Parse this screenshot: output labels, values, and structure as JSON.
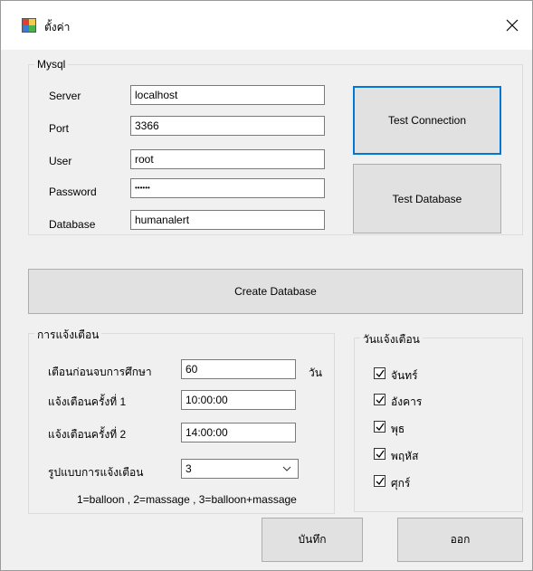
{
  "window": {
    "title": "ตั้งค่า",
    "close_glyph": "✕"
  },
  "mysql": {
    "legend": "Mysql",
    "server_label": "Server",
    "server_value": "localhost",
    "port_label": "Port",
    "port_value": "3366",
    "user_label": "User",
    "user_value": "root",
    "password_label": "Password",
    "password_value": "••••••",
    "database_label": "Database",
    "database_value": "humanalert",
    "test_connection_label": "Test Connection",
    "test_database_label": "Test Database"
  },
  "create_database_label": "Create Database",
  "alert": {
    "legend": "การแจ้งเตือน",
    "before_grad_label": "เตือนก่อนจบการศึกษา",
    "before_grad_value": "60",
    "before_grad_unit": "วัน",
    "alert1_label": "แจ้งเตือนครั้งที่ 1",
    "alert1_value": "10:00:00",
    "alert2_label": "แจ้งเตือนครั้งที่ 2",
    "alert2_value": "14:00:00",
    "format_label": "รูปแบบการแจ้งเตือน",
    "format_value": "3",
    "format_hint": "1=balloon , 2=massage , 3=balloon+massage"
  },
  "days": {
    "legend": "วันแจ้งเตือน",
    "items": [
      {
        "label": "จันทร์",
        "checked": true
      },
      {
        "label": "อังคาร",
        "checked": true
      },
      {
        "label": "พุธ",
        "checked": true
      },
      {
        "label": "พฤหัส",
        "checked": true
      },
      {
        "label": "ศุกร์",
        "checked": true
      }
    ]
  },
  "save_label": "บันทึก",
  "exit_label": "ออก"
}
